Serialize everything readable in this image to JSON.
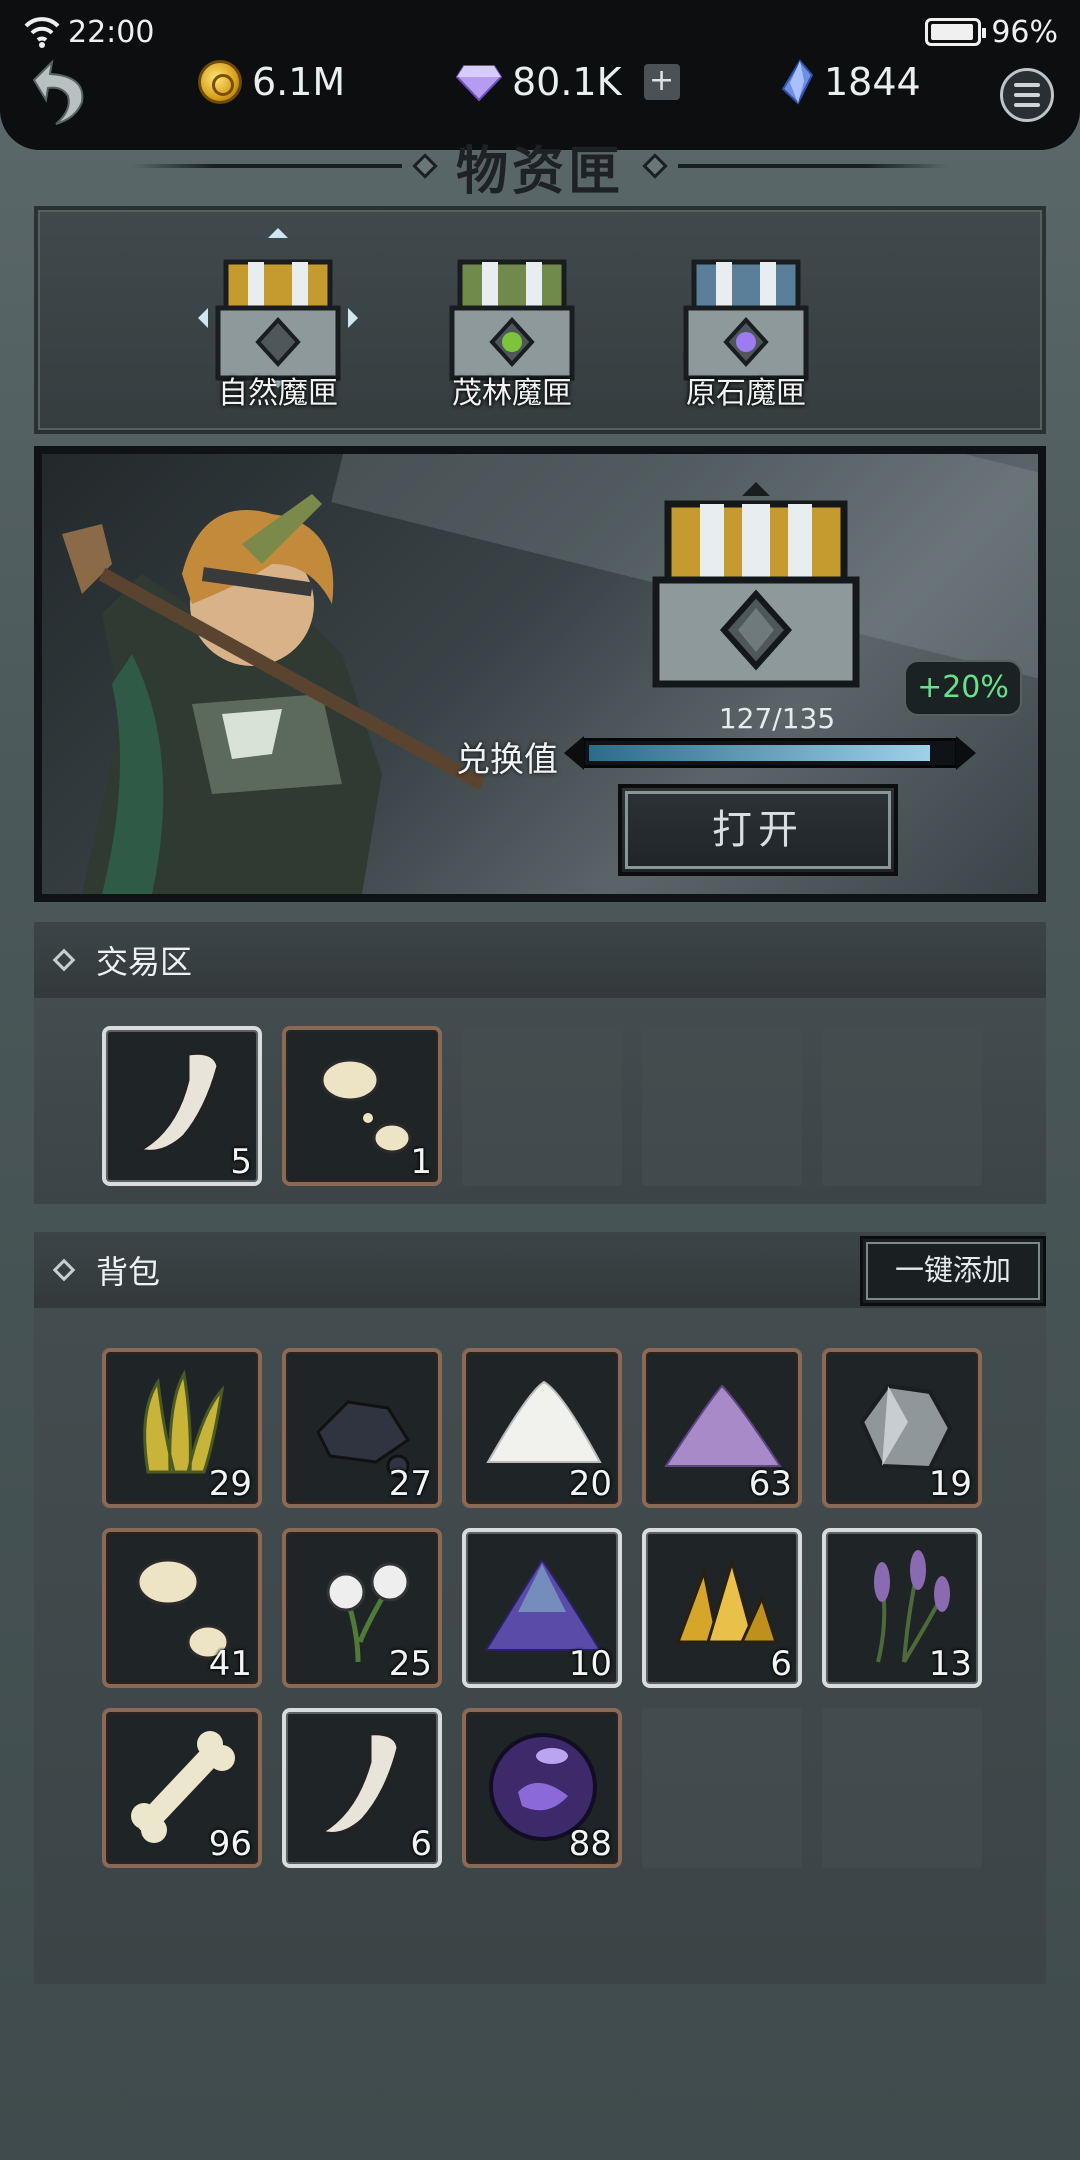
{
  "status": {
    "time": "22:00",
    "battery": "96%"
  },
  "currencies": {
    "gold": "6.1M",
    "diamond": "80.1K",
    "crystal": "1844",
    "plus": "+"
  },
  "title": "物资匣",
  "chests": [
    {
      "label": "自然魔匣",
      "color": "#c59a2e"
    },
    {
      "label": "茂林魔匣",
      "color": "#6f8a4a"
    },
    {
      "label": "原石魔匣",
      "color": "#5b7f98"
    }
  ],
  "showcase": {
    "bonus": "+20%",
    "progress_text": "127/135",
    "progress_current": 127,
    "progress_max": 135,
    "exchange_label": "兑换值",
    "open_label": "打开"
  },
  "trade": {
    "header": "交易区",
    "slots": [
      {
        "item": "fang",
        "count": "5",
        "frame": "white"
      },
      {
        "item": "bone-fragments",
        "count": "1",
        "frame": "bronze"
      }
    ]
  },
  "bag": {
    "header": "背包",
    "add_all": "一键添加",
    "slots": [
      {
        "item": "yellow-herb",
        "count": "29",
        "frame": "bronze"
      },
      {
        "item": "coal",
        "count": "27",
        "frame": "bronze"
      },
      {
        "item": "white-powder",
        "count": "20",
        "frame": "bronze"
      },
      {
        "item": "purple-powder",
        "count": "63",
        "frame": "bronze"
      },
      {
        "item": "silver-ore",
        "count": "19",
        "frame": "bronze"
      },
      {
        "item": "bone-fragments",
        "count": "41",
        "frame": "bronze"
      },
      {
        "item": "dandelion",
        "count": "25",
        "frame": "bronze"
      },
      {
        "item": "starry-powder",
        "count": "10",
        "frame": "white"
      },
      {
        "item": "gold-crystal",
        "count": "6",
        "frame": "white"
      },
      {
        "item": "lavender",
        "count": "13",
        "frame": "white"
      },
      {
        "item": "bone",
        "count": "96",
        "frame": "bronze"
      },
      {
        "item": "fang",
        "count": "6",
        "frame": "white"
      },
      {
        "item": "void-orb",
        "count": "88",
        "frame": "bronze"
      }
    ]
  }
}
